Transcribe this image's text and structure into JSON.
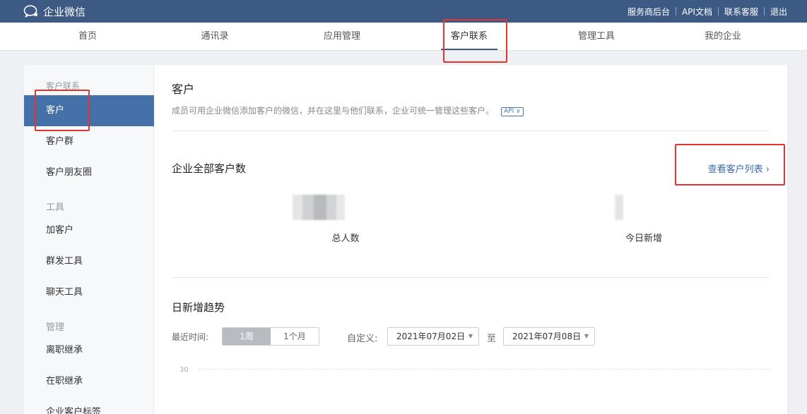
{
  "header": {
    "logo_text": "企业微信",
    "links": [
      "服务商后台",
      "API文档",
      "联系客服",
      "退出"
    ]
  },
  "nav": {
    "items": [
      "首页",
      "通讯录",
      "应用管理",
      "客户联系",
      "管理工具",
      "我的企业"
    ],
    "active_index": 3
  },
  "sidebar": {
    "group_customer": "客户联系",
    "item_customer": "客户",
    "item_group": "客户群",
    "item_moments": "客户朋友圈",
    "group_tools": "工具",
    "item_add": "加客户",
    "item_broadcast": "群发工具",
    "item_chat": "聊天工具",
    "group_manage": "管理",
    "item_resign": "离职继承",
    "item_onjob": "在职继承",
    "item_tags": "企业客户标签"
  },
  "content": {
    "title": "客户",
    "description": "成员可用企业微信添加客户的微信，并在这里与他们联系，企业可统一管理这些客户。",
    "api_badge": "API ∨",
    "total_section_title": "企业全部客户数",
    "view_list_link": "查看客户列表 ›",
    "stat_total_label": "总人数",
    "stat_today_label": "今日新增",
    "trend_title": "日新增趋势",
    "recent_time_label": "最近时间:",
    "range_week": "1周",
    "range_month": "1个月",
    "custom_label": "自定义:",
    "date_start": "2021年07月02日",
    "to_label": "至",
    "date_end": "2021年07月08日",
    "axis_tick_top": "30"
  },
  "colors": {
    "topbar": "#3d5a84",
    "active_sidebar": "#4472a8",
    "link": "#3a6cae",
    "highlight_box": "#e5332f"
  }
}
